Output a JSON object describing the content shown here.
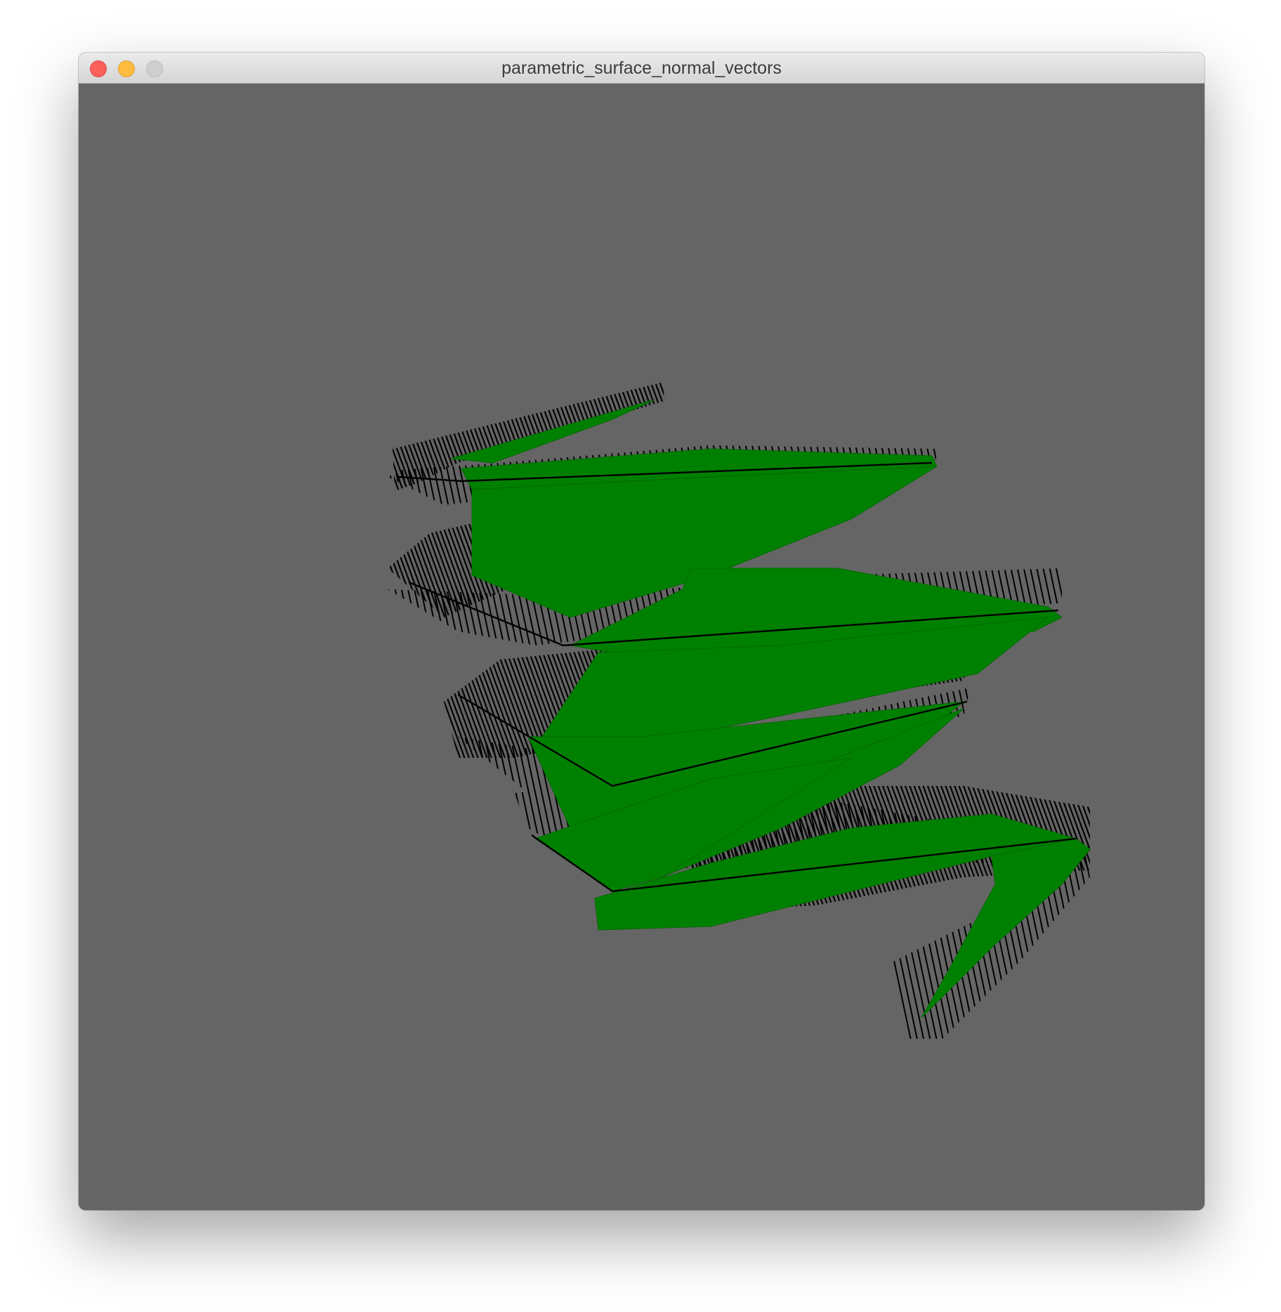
{
  "window": {
    "title": "parametric_surface_normal_vectors"
  },
  "controls": {
    "close": "close-icon",
    "minimize": "minimize-icon",
    "zoom": "zoom-icon"
  },
  "scene": {
    "background_color": "#656565",
    "surface_color": "#008000",
    "normal_color": "#000000"
  }
}
